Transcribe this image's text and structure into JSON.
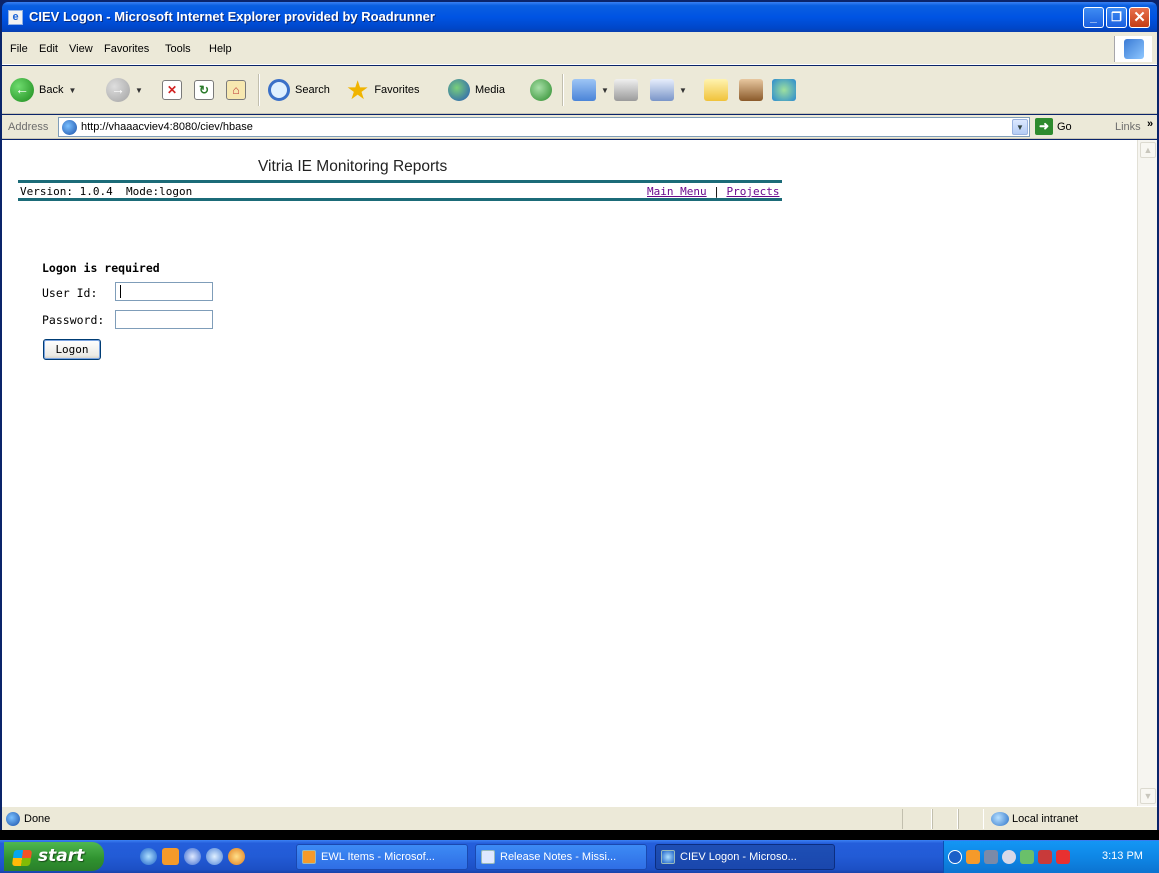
{
  "window": {
    "title": "CIEV Logon - Microsoft Internet Explorer provided by Roadrunner"
  },
  "menu": {
    "items": [
      "File",
      "Edit",
      "View",
      "Favorites",
      "Tools",
      "Help"
    ]
  },
  "toolbar": {
    "back_label": "Back",
    "search_label": "Search",
    "favorites_label": "Favorites",
    "media_label": "Media"
  },
  "address_bar": {
    "label": "Address",
    "url": "http://vhaaacviev4:8080/ciev/hbase",
    "go_label": "Go",
    "links_label": "Links"
  },
  "page": {
    "report_title": "Vitria IE Monitoring Reports",
    "version_text": "Version: 1.0.4  Mode:logon",
    "links": [
      "Main Menu",
      "Projects"
    ],
    "link_separator": "|",
    "logon_heading": "Logon is required",
    "userid_label": "User Id:",
    "password_label": "Password:",
    "userid_value": "",
    "password_value": "",
    "logon_button": "Logon"
  },
  "status_bar": {
    "status": "Done",
    "zone": "Local intranet"
  },
  "taskbar": {
    "start_label": "start",
    "tasks": [
      "EWL Items - Microsof...",
      "Release Notes - Missi...",
      "CIEV Logon - Microso..."
    ],
    "active_task": "CIEV Logon - Microso...",
    "clock": "3:13 PM"
  },
  "colors": {
    "rule": "#1b6b78",
    "link": "#6a0a8c",
    "titlebar": "#0054e3",
    "taskbar": "#225bd6",
    "start": "#2f912f"
  }
}
